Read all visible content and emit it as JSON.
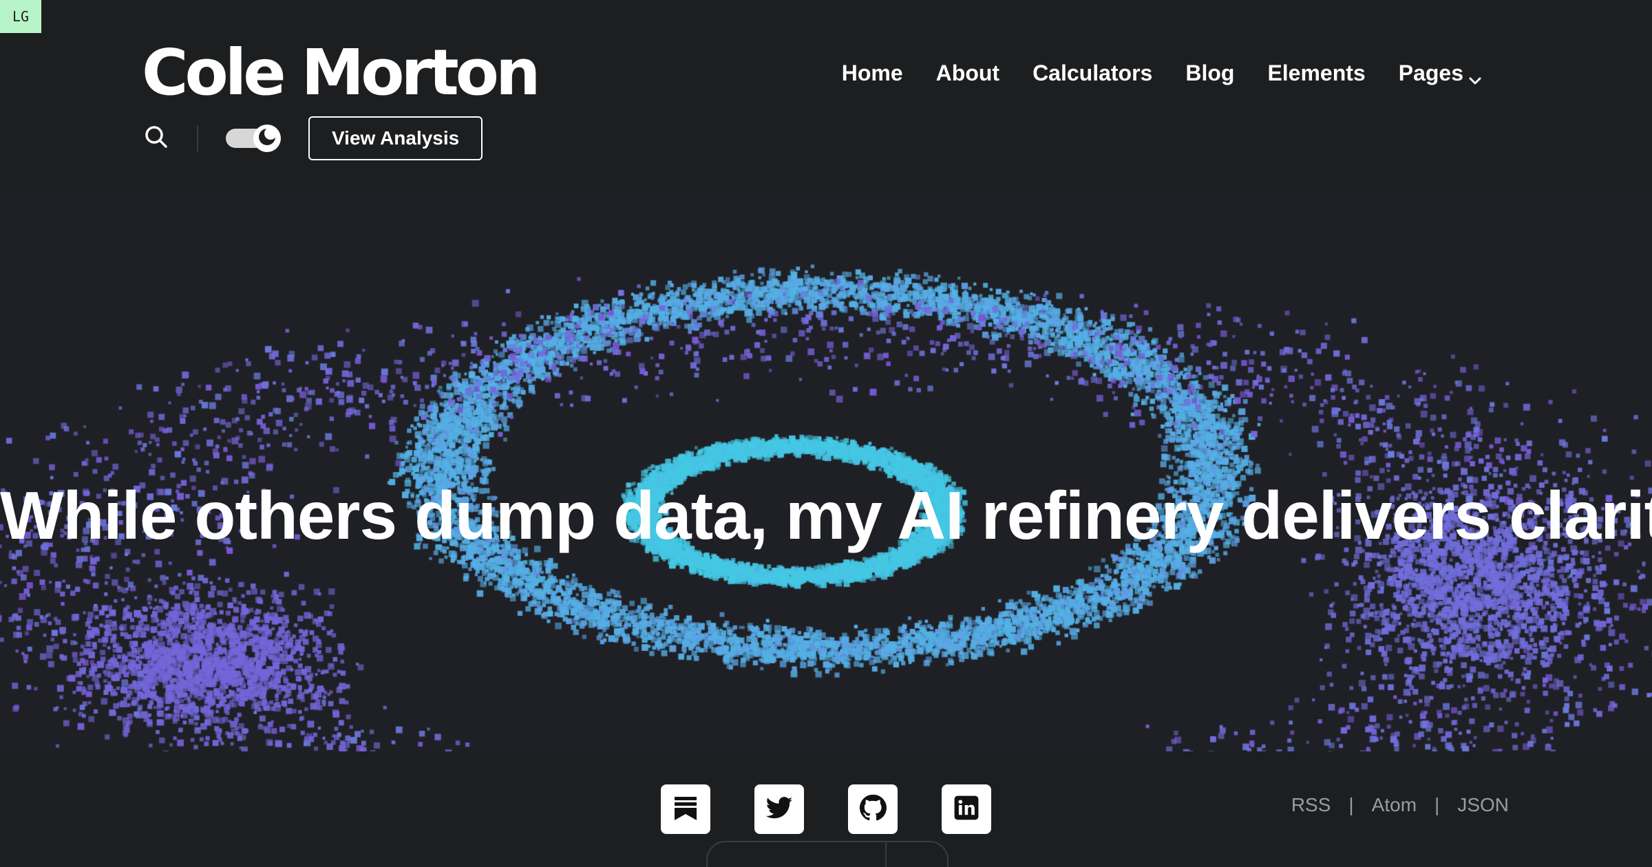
{
  "breakpoint_badge": "LG",
  "site": {
    "logo": "Cole Morton"
  },
  "nav": {
    "items": [
      {
        "label": "Home"
      },
      {
        "label": "About"
      },
      {
        "label": "Calculators"
      },
      {
        "label": "Blog"
      },
      {
        "label": "Elements"
      },
      {
        "label": "Pages"
      }
    ]
  },
  "toolbar": {
    "search_icon": "search-icon",
    "theme_toggle": "dark",
    "cta_label": "View Analysis"
  },
  "hero": {
    "headline": "While others dump data, my AI refinery delivers clarity.",
    "colors": {
      "inner": "#3fd0e3",
      "mid": "#5aa8e6",
      "outer": "#7b55d6"
    }
  },
  "footer": {
    "socials": [
      {
        "icon": "substack-icon"
      },
      {
        "icon": "twitter-icon"
      },
      {
        "icon": "github-icon"
      },
      {
        "icon": "linkedin-icon"
      }
    ],
    "feeds": [
      "RSS",
      "Atom",
      "JSON"
    ]
  },
  "colors": {
    "background": "#1d1e20",
    "hero_background": "#1f2025",
    "text": "#ffffff",
    "muted": "#9a9ca1"
  }
}
